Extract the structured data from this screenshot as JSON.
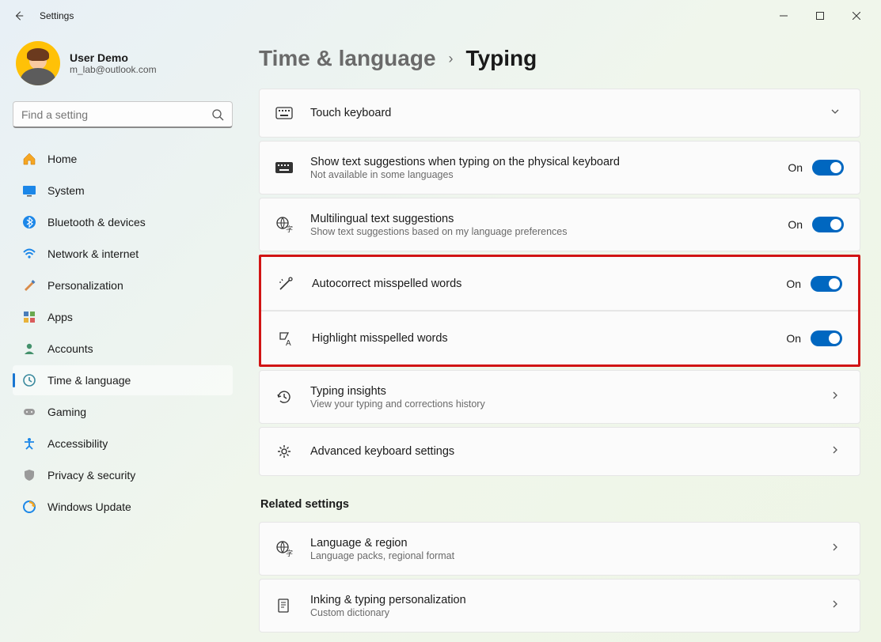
{
  "window": {
    "title": "Settings"
  },
  "profile": {
    "name": "User Demo",
    "email": "m_lab@outlook.com"
  },
  "search": {
    "placeholder": "Find a setting"
  },
  "nav": {
    "items": [
      {
        "label": "Home"
      },
      {
        "label": "System"
      },
      {
        "label": "Bluetooth & devices"
      },
      {
        "label": "Network & internet"
      },
      {
        "label": "Personalization"
      },
      {
        "label": "Apps"
      },
      {
        "label": "Accounts"
      },
      {
        "label": "Time & language"
      },
      {
        "label": "Gaming"
      },
      {
        "label": "Accessibility"
      },
      {
        "label": "Privacy & security"
      },
      {
        "label": "Windows Update"
      }
    ]
  },
  "breadcrumb": {
    "parent": "Time & language",
    "current": "Typing"
  },
  "cards": {
    "touch_keyboard": {
      "title": "Touch keyboard"
    },
    "physical_suggestions": {
      "title": "Show text suggestions when typing on the physical keyboard",
      "sub": "Not available in some languages",
      "state": "On"
    },
    "multilingual": {
      "title": "Multilingual text suggestions",
      "sub": "Show text suggestions based on my language preferences",
      "state": "On"
    },
    "autocorrect": {
      "title": "Autocorrect misspelled words",
      "state": "On"
    },
    "highlight": {
      "title": "Highlight misspelled words",
      "state": "On"
    },
    "insights": {
      "title": "Typing insights",
      "sub": "View your typing and corrections history"
    },
    "advanced": {
      "title": "Advanced keyboard settings"
    }
  },
  "related": {
    "header": "Related settings",
    "language_region": {
      "title": "Language & region",
      "sub": "Language packs, regional format"
    },
    "inking": {
      "title": "Inking & typing personalization",
      "sub": "Custom dictionary"
    }
  }
}
